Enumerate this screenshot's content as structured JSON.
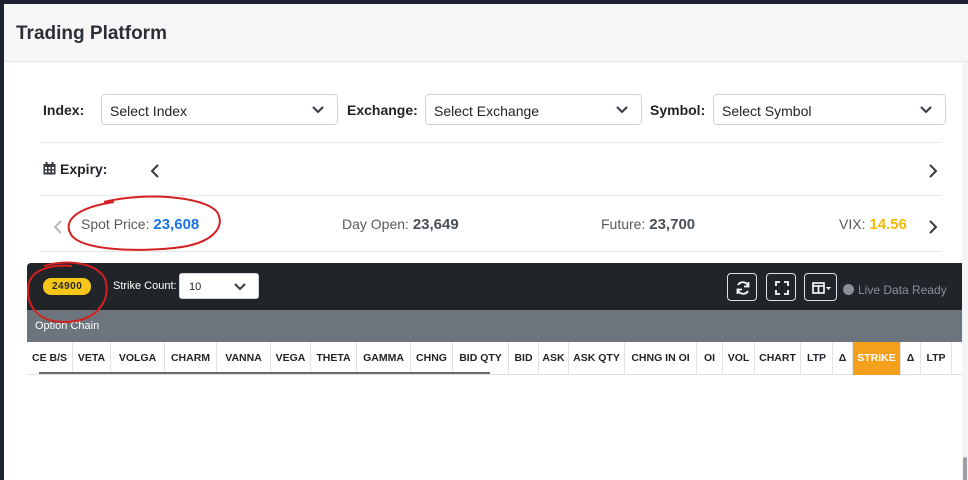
{
  "app": {
    "title": "Trading Platform"
  },
  "filters": {
    "index": {
      "label": "Index:",
      "value": "Select Index"
    },
    "exchange": {
      "label": "Exchange:",
      "value": "Select Exchange"
    },
    "symbol": {
      "label": "Symbol:",
      "value": "Select Symbol"
    }
  },
  "expiry": {
    "label": "Expiry:"
  },
  "prices": {
    "spot": {
      "label": "Spot Price:",
      "value": "23,608"
    },
    "day_open": {
      "label": "Day Open:",
      "value": "23,649"
    },
    "future": {
      "label": "Future:",
      "value": "23,700"
    },
    "vix": {
      "label": "VIX:",
      "value": "14.56"
    }
  },
  "toolbar": {
    "badge": "24900",
    "strike_count_label": "Strike Count:",
    "strike_count_value": "10",
    "live_status": "Live Data Ready"
  },
  "option_chain": {
    "title": "Option Chain",
    "columns": [
      "CE B/S",
      "VETA",
      "VOLGA",
      "CHARM",
      "VANNA",
      "VEGA",
      "THETA",
      "GAMMA",
      "CHNG",
      "BID QTY",
      "BID",
      "ASK",
      "ASK QTY",
      "CHNG IN OI",
      "OI",
      "VOL",
      "CHART",
      "LTP",
      "Δ",
      "STRIKE",
      "Δ",
      "LTP"
    ]
  },
  "colors": {
    "spot_value": "#1a73e8",
    "vix_value": "#f5b800",
    "badge": "#f5c518",
    "strike_header": "#f5a01a",
    "annotation": "#d42020"
  }
}
